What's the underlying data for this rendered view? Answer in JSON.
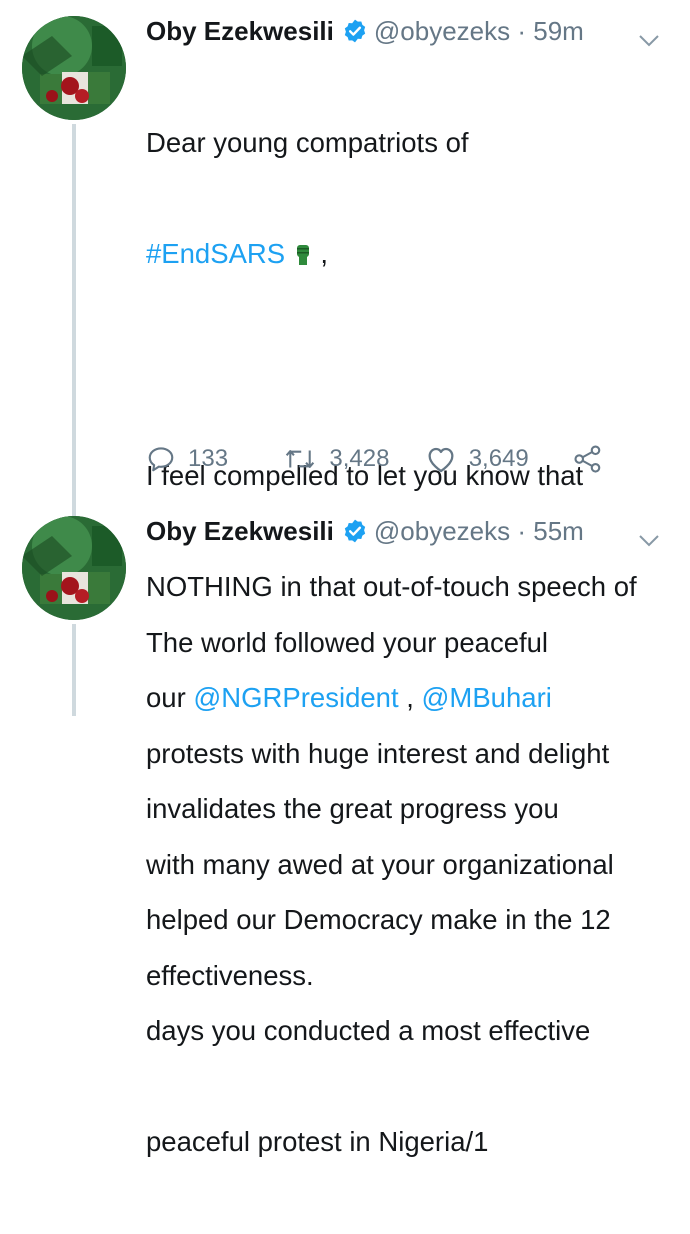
{
  "tweets": [
    {
      "author_name": "Oby Ezekwesili",
      "handle": "@obyezeks",
      "separator": "·",
      "time": "59m",
      "body": {
        "line1": "Dear young compatriots of",
        "hashtag": "#EndSARS",
        "hashtag_suffix": " ,",
        "line3": "I feel compelled to let you know that",
        "line4": "NOTHING in that out-of-touch speech of",
        "line5_prefix": "our ",
        "mention1": "@NGRPresident",
        "mention_sep": " , ",
        "mention2": "@MBuhari",
        "line6": "invalidates the great progress you",
        "line7": "helped our Democracy make in the 12",
        "line8": "days you conducted a most effective",
        "line9": "peaceful protest in Nigeria/1"
      },
      "replies": "133",
      "retweets": "3,428",
      "likes": "3,649"
    },
    {
      "author_name": "Oby Ezekwesili",
      "handle": "@obyezeks",
      "separator": "·",
      "time": "55m",
      "body_lines": [
        "The world followed your peaceful",
        "protests with huge interest and delight",
        "with many awed at your organizational",
        "effectiveness."
      ]
    }
  ],
  "colors": {
    "link": "#1da1f2",
    "muted": "#657786",
    "verified": "#1da1f2",
    "thread": "#cfd9de"
  },
  "icons": [
    "verified-badge-icon",
    "chevron-down-icon",
    "reply-icon",
    "retweet-icon",
    "like-icon",
    "share-icon",
    "raised-fist-emoji"
  ]
}
